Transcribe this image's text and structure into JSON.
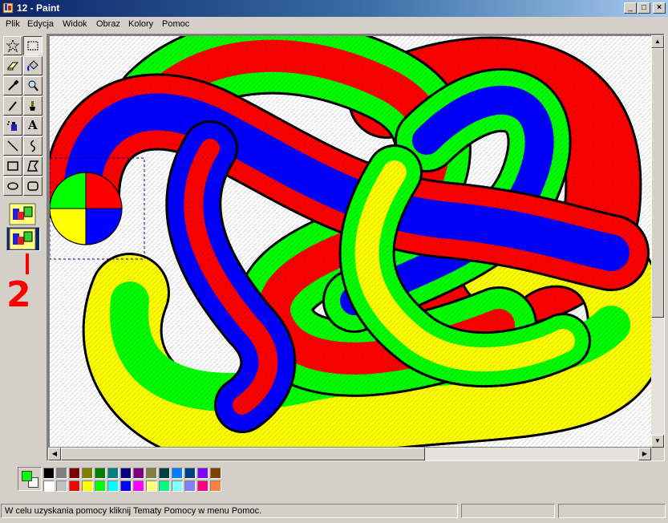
{
  "window": {
    "title": "12 - Paint",
    "buttons": {
      "minimize": "_",
      "maximize": "□",
      "close": "×"
    }
  },
  "menu": [
    "Plik",
    "Edycja",
    "Widok",
    "Obraz",
    "Kolory",
    "Pomoc"
  ],
  "toolbox": {
    "tools": [
      {
        "name": "free-form-select",
        "icon": "star-select-icon"
      },
      {
        "name": "select",
        "icon": "rect-select-icon",
        "selected": true
      },
      {
        "name": "eraser",
        "icon": "eraser-icon"
      },
      {
        "name": "fill",
        "icon": "paint-bucket-icon"
      },
      {
        "name": "pick-color",
        "icon": "eyedropper-icon"
      },
      {
        "name": "magnifier",
        "icon": "magnifier-icon"
      },
      {
        "name": "pencil",
        "icon": "pencil-icon"
      },
      {
        "name": "brush",
        "icon": "brush-icon"
      },
      {
        "name": "airbrush",
        "icon": "airbrush-icon"
      },
      {
        "name": "text",
        "icon": "text-icon",
        "label": "A"
      },
      {
        "name": "line",
        "icon": "line-icon"
      },
      {
        "name": "curve",
        "icon": "curve-icon"
      },
      {
        "name": "rectangle",
        "icon": "rectangle-icon"
      },
      {
        "name": "polygon",
        "icon": "polygon-icon"
      },
      {
        "name": "ellipse",
        "icon": "ellipse-icon"
      },
      {
        "name": "rounded-rectangle",
        "icon": "rounded-rect-icon"
      }
    ],
    "options": [
      "opaque-selection",
      "transparent-selection"
    ]
  },
  "annotations": {
    "one": "1",
    "two": "2"
  },
  "palette": {
    "foreground": "#00ff00",
    "background": "#ffffff",
    "row1": [
      "#000000",
      "#808080",
      "#800000",
      "#808000",
      "#008000",
      "#008080",
      "#000080",
      "#800080",
      "#808040",
      "#004040",
      "#0080ff",
      "#004080",
      "#8000ff",
      "#804000"
    ],
    "row2": [
      "#ffffff",
      "#c0c0c0",
      "#ff0000",
      "#ffff00",
      "#00ff00",
      "#00ffff",
      "#0000ff",
      "#ff00ff",
      "#ffff80",
      "#00ff80",
      "#80ffff",
      "#8080ff",
      "#ff0080",
      "#ff8040"
    ]
  },
  "status": {
    "text": "W celu uzyskania pomocy kliknij Tematy Pomocy w menu Pomoc."
  },
  "colors": {
    "tube_green": "#00ff00",
    "tube_red": "#ff0000",
    "tube_blue": "#0000ff",
    "tube_yellow": "#ffff00"
  }
}
